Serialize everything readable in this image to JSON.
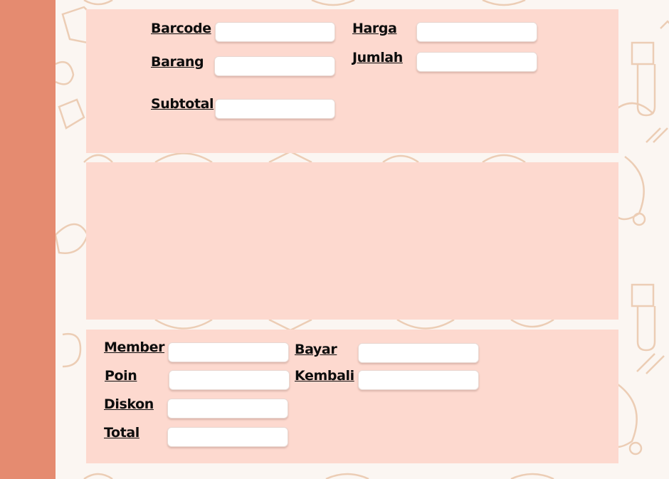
{
  "colors": {
    "sidebar": "#e58b70",
    "panel": "#fdd9cf",
    "background": "#fbf6f2",
    "pattern": "#eccdb5"
  },
  "item_form": {
    "barcode_label": "Barcode",
    "barang_label": "Barang",
    "subtotal_label": "Subtotal",
    "harga_label": "Harga",
    "jumlah_label": "Jumlah",
    "barcode_value": "",
    "barang_value": "",
    "subtotal_value": "",
    "harga_value": "",
    "jumlah_value": ""
  },
  "payment_form": {
    "member_label": "Member",
    "poin_label": "Poin",
    "diskon_label": "Diskon",
    "total_label": "Total",
    "bayar_label": "Bayar",
    "kembali_label": "Kembali",
    "member_value": "",
    "poin_value": "",
    "diskon_value": "",
    "total_value": "",
    "bayar_value": "",
    "kembali_value": ""
  }
}
